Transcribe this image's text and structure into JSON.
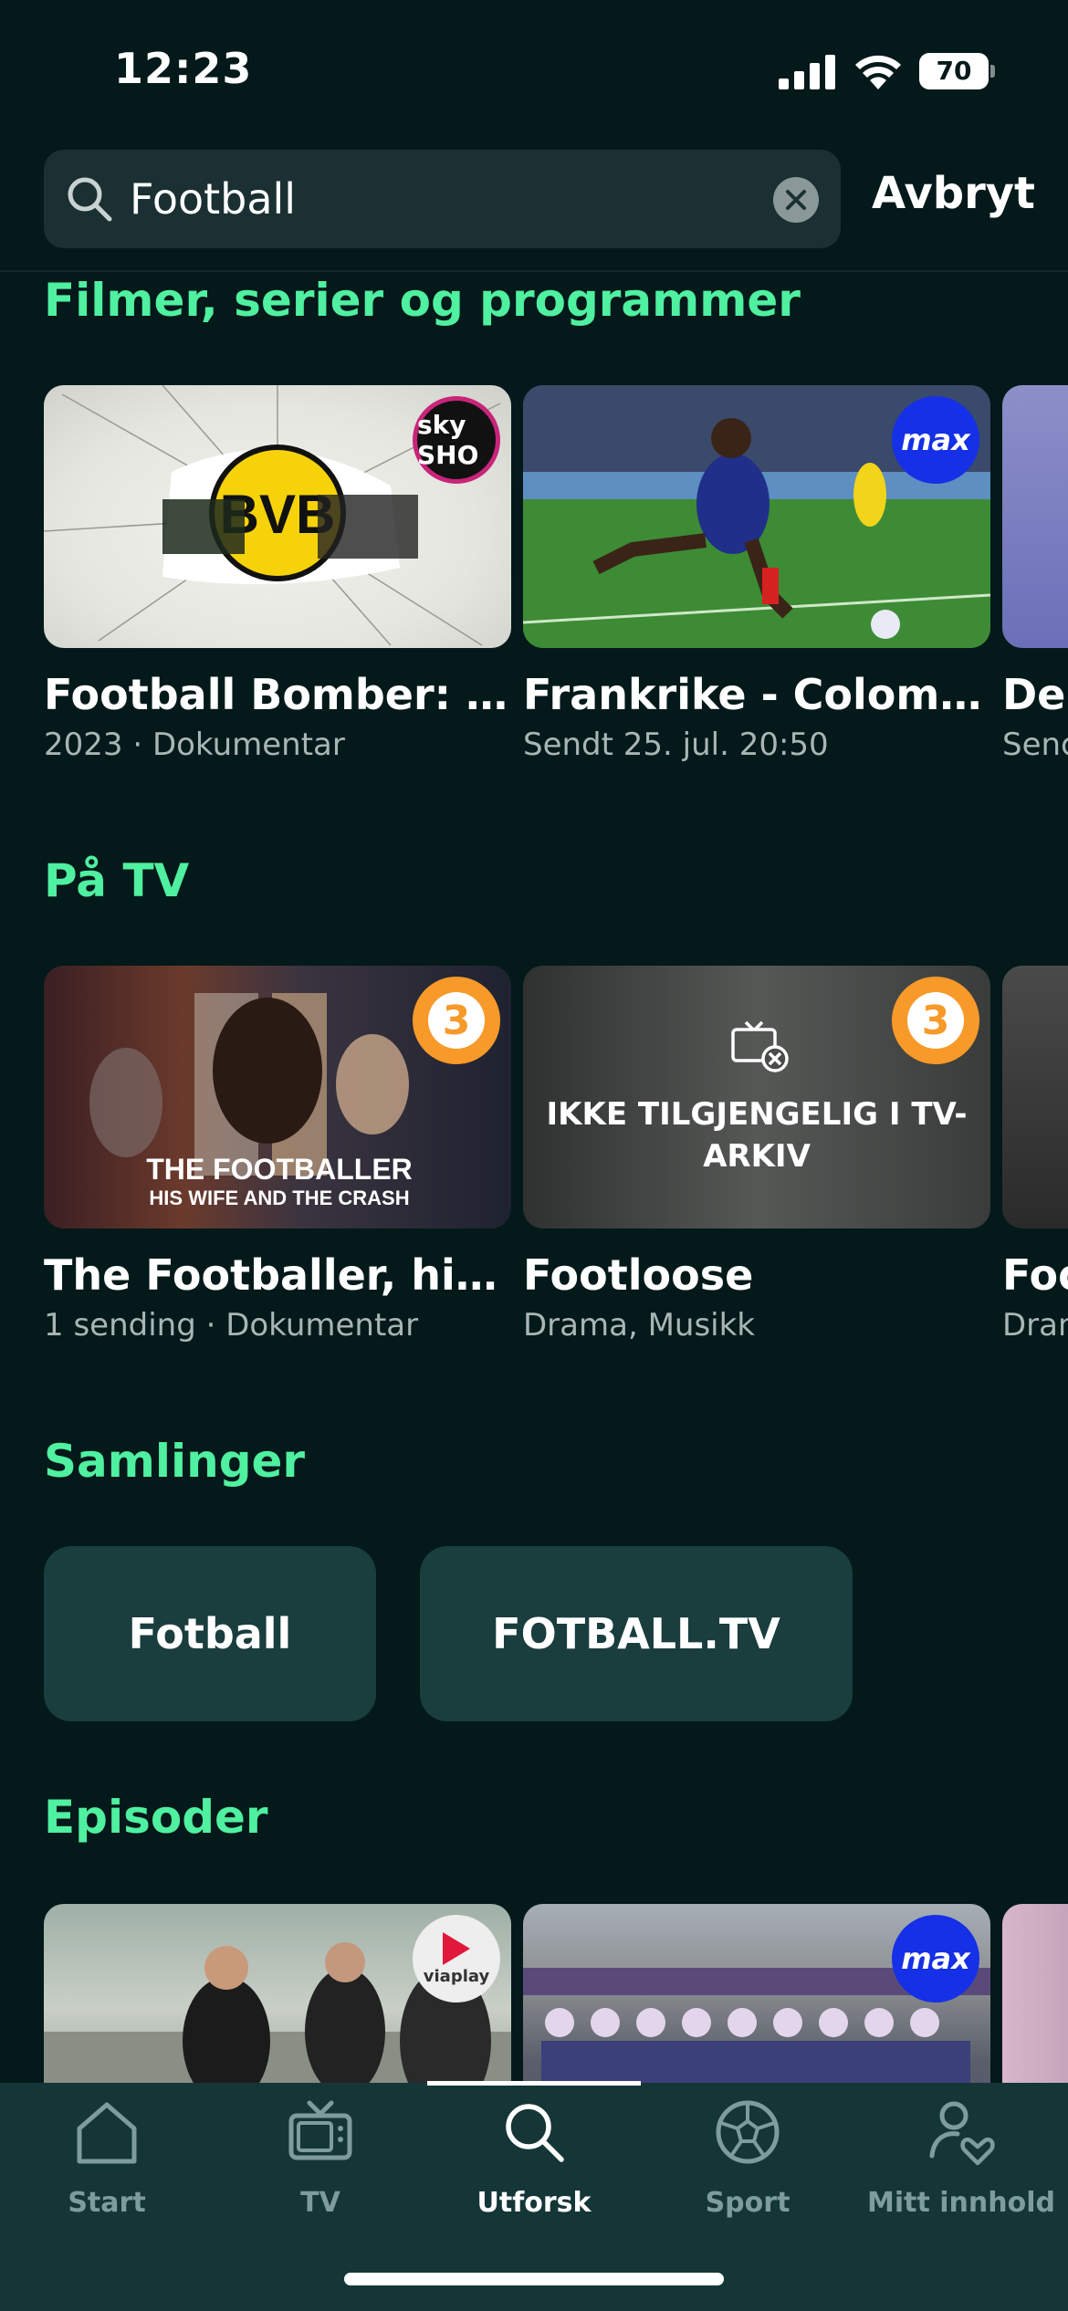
{
  "status": {
    "time": "12:23",
    "battery": "70"
  },
  "search": {
    "query": "Football",
    "cancel_label": "Avbryt"
  },
  "sections": {
    "films": {
      "title": "Filmer, serier og programmer",
      "items": [
        {
          "title": "Football Bomber: At…",
          "subtitle": "2023 · Dokumentar",
          "badge": "sky SHO"
        },
        {
          "title": "Frankrike - Colombia",
          "subtitle": "Sendt 25. jul. 20:50",
          "badge": "max"
        },
        {
          "title": "Der",
          "subtitle": "Senc"
        }
      ]
    },
    "tv": {
      "title": "På TV",
      "items": [
        {
          "title": "The Footballer, his…",
          "subtitle": "1 sending · Dokumentar",
          "badge": "3",
          "thumb_text_1": "THE FOOTBALLER",
          "thumb_text_2": "HIS WIFE AND THE CRASH"
        },
        {
          "title": "Footloose",
          "subtitle": "Drama, Musikk",
          "badge": "3",
          "overlay": "IKKE TILGJENGELIG I TV-ARKIV"
        },
        {
          "title": "Foo",
          "subtitle": "Dran"
        }
      ]
    },
    "collections": {
      "title": "Samlinger",
      "items": [
        "Fotball",
        "FOTBALL.TV"
      ]
    },
    "episodes": {
      "title": "Episoder",
      "items": [
        {
          "badge": "viaplay"
        },
        {
          "badge": "max"
        }
      ]
    }
  },
  "tabs": [
    {
      "label": "Start",
      "icon": "home-icon"
    },
    {
      "label": "TV",
      "icon": "tv-icon"
    },
    {
      "label": "Utforsk",
      "icon": "search-icon",
      "active": true
    },
    {
      "label": "Sport",
      "icon": "football-icon"
    },
    {
      "label": "Mitt innhold",
      "icon": "profile-heart-icon"
    }
  ],
  "colors": {
    "background": "#03191a",
    "accent": "#4ff0a0",
    "tabbar": "#153637",
    "chip": "#1a3d3e"
  }
}
